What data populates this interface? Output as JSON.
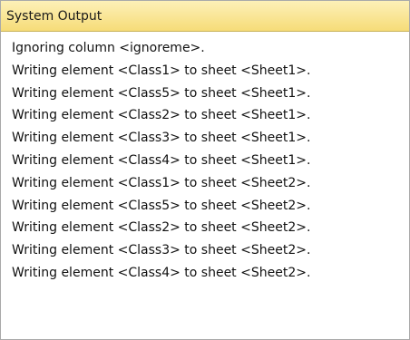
{
  "panel": {
    "title": "System Output",
    "title_bg_top": "#fdf0b8",
    "title_bg_bottom": "#f6dc78"
  },
  "output": {
    "lines": [
      "Ignoring column <ignoreme>.",
      "Writing element <Class1> to sheet <Sheet1>.",
      "Writing element <Class5> to sheet <Sheet1>.",
      "Writing element <Class2> to sheet <Sheet1>.",
      "Writing element <Class3> to sheet <Sheet1>.",
      "Writing element <Class4> to sheet <Sheet1>.",
      "Writing element <Class1> to sheet <Sheet2>.",
      "Writing element <Class5> to sheet <Sheet2>.",
      "Writing element <Class2> to sheet <Sheet2>.",
      "Writing element <Class3> to sheet <Sheet2>.",
      "Writing element <Class4> to sheet <Sheet2>."
    ]
  }
}
